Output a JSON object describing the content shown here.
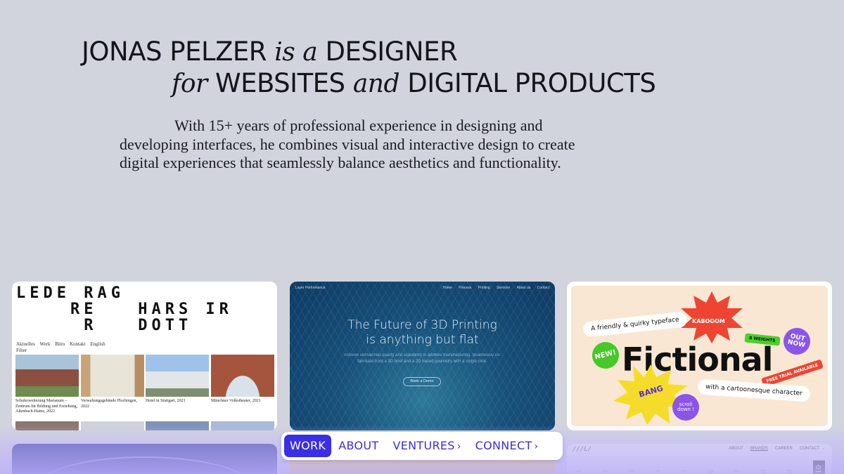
{
  "hero": {
    "name": "JONAS PELZER",
    "is_a": "is a",
    "role": "DESIGNER",
    "for": "for",
    "websites": "WEBSITES",
    "and": "and",
    "products": "DIGITAL PRODUCTS",
    "intro": "With 15+ years of professional experience in designing and developing interfaces, he combines visual and interactive design to create digital experiences that seamlessly balance aesthetics and functionality."
  },
  "cards": {
    "architecture": {
      "logo_text": "LEDE RAG\n    RE   HARS IR\n     R   DOTT",
      "menu": [
        "Aktuelles",
        "Werk",
        "Büro",
        "Kontakt",
        "English"
      ],
      "filter": "Filter",
      "captions": [
        "Schulerweiterung Marianum – Zentrum für Bildung und Erziehung, Altenbach-Hame, 2022",
        "Verwaltungsgebäude Plochingen, 2022",
        "Hotel in Stuttgart, 2021",
        "Münchner Volkstheater, 2021"
      ]
    },
    "printing": {
      "brand": "Layer Performance",
      "nav": [
        "Home",
        "Process",
        "Printing",
        "Services",
        "About us",
        "Contact"
      ],
      "title_line1": "The Future of 3D Printing",
      "title_line2": "is anything but flat",
      "subtitle": "Achieve unmatched quality and scalability in additive manufacturing. Seamlessly co-fabricate from a 3D brief and a 2D based geometry with a single click.",
      "button": "Book a Demo"
    },
    "typeface": {
      "word": "Fictional",
      "tagline_top": "A friendly & quirky typeface",
      "tagline_bottom": "with a cartoonesque character",
      "kaboom": "KABOOOM",
      "weights": "8 WEIGHTS",
      "out_now": "OUT NOW",
      "new": "NEW!",
      "bang": "BANG",
      "free_trial": "FREE TRIAL AVAILABLE",
      "scroll": "scroll down !"
    },
    "brands_site": {
      "mark": "///L/",
      "nav": [
        "ABOUT",
        "BRANDS",
        "CAREER",
        "CONTACT →"
      ],
      "numbers": [
        "01",
        "02",
        "03",
        "04",
        "05",
        "06",
        "07",
        "08",
        "09",
        "10"
      ]
    }
  },
  "nav": {
    "work": "WORK",
    "about": "ABOUT",
    "ventures": "VENTURES",
    "connect": "CONNECT",
    "chevron": "›"
  },
  "colors": {
    "accent": "#3a2ee6",
    "background": "#d1d4dc"
  }
}
